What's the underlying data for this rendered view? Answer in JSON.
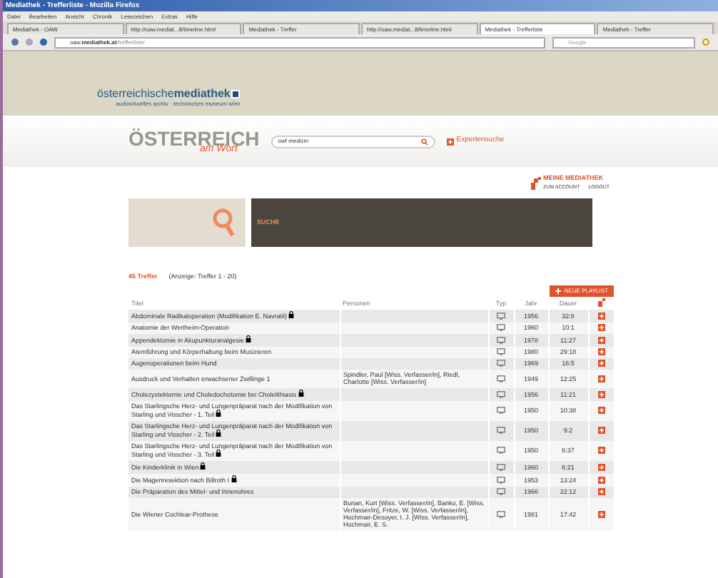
{
  "window": {
    "title": "Mediathek - Trefferliste - Mozilla Firefox"
  },
  "menu": [
    "Datei",
    "Bearbeiten",
    "Ansicht",
    "Chronik",
    "Lesezeichen",
    "Extras",
    "Hilfe"
  ],
  "tabs": [
    {
      "label": "Mediathek - OAW",
      "selected": false
    },
    {
      "label": "http://oaw.mediat...8/timeline.html",
      "selected": false
    },
    {
      "label": "Mediathek - Treffer",
      "selected": false
    },
    {
      "label": "http://oaw.mediat...8/timeline.html",
      "selected": false
    },
    {
      "label": "Mediathek - Trefferliste",
      "selected": true
    },
    {
      "label": "Mediathek - Treffer",
      "selected": false
    }
  ],
  "address": {
    "prefix": "oaw.",
    "domain": "mediathek.at",
    "path": "/trefferliste/"
  },
  "search_engine": {
    "placeholder": "Google"
  },
  "site": {
    "logo_main": "österreichische",
    "logo_bold": "mediathek",
    "logo_sub": "audiovisuelles archiv · technisches museum wien",
    "brand_top": "ÖSTERREICH",
    "brand_bottom": "am Wort",
    "query": "owf medizin",
    "expert_search": "Expertensuche",
    "my_mediathek": "MEINE MEDIATHEK",
    "account": "ZUM ACCOUNT",
    "logout": "LOGOUT",
    "search_panel": "SUCHE"
  },
  "results": {
    "count": "45 Treffer",
    "range": "(Anzeige: Treffer 1 - 20)",
    "new_playlist": "NEUE PLAYLIST"
  },
  "table": {
    "columns": [
      "Titel",
      "Personen",
      "Typ",
      "Jahr",
      "Dauer"
    ],
    "rows": [
      {
        "title": "Abdominale Radikaloperation (Modifikation E. Navratil)",
        "locked": true,
        "persons": "",
        "year": "1956",
        "duration": "32:8"
      },
      {
        "title": "Anatomie der Wertheim-Operation",
        "locked": false,
        "persons": "",
        "year": "1960",
        "duration": "10:1"
      },
      {
        "title": "Appendektomie in Akupunkturanalgesie",
        "locked": true,
        "persons": "",
        "year": "1978",
        "duration": "11:27"
      },
      {
        "title": "Atemführung und Körperhaltung beim Musizieren",
        "locked": false,
        "persons": "",
        "year": "1980",
        "duration": "29:18"
      },
      {
        "title": "Augenoperationen beim Hund",
        "locked": false,
        "persons": "",
        "year": "1969",
        "duration": "16:5"
      },
      {
        "title": "Ausdruck und Verhalten erwachsener Zwillinge 1",
        "locked": false,
        "persons": "Spindler, Paul [Wiss. Verfasser/in], Riedl, Charlotte [Wiss. Verfasser/in]",
        "year": "1949",
        "duration": "12:25"
      },
      {
        "title": "Cholezystektomie und Choledochotomie bei Cholelithiasis",
        "locked": true,
        "persons": "",
        "year": "1956",
        "duration": "11:21"
      },
      {
        "title": "Das Starlingsche Herz- und Lungenpräparat nach der Modifikation von Starling und Visscher - 1. Teil",
        "locked": true,
        "persons": "",
        "year": "1950",
        "duration": "10:38"
      },
      {
        "title": "Das Starlingsche Herz- und Lungenpräparat nach der Modifikation von Starling und Visscher - 2. Teil",
        "locked": true,
        "persons": "",
        "year": "1950",
        "duration": "9:2"
      },
      {
        "title": "Das Starlingsche Herz- und Lungenpräparat nach der Modifikation von Starling und Visscher - 3. Teil",
        "locked": true,
        "persons": "",
        "year": "1950",
        "duration": "6:37"
      },
      {
        "title": "Die Kinderklinik in Wien",
        "locked": true,
        "persons": "",
        "year": "1960",
        "duration": "6:21"
      },
      {
        "title": "Die Magenresektion nach Billroth I",
        "locked": true,
        "persons": "",
        "year": "1953",
        "duration": "13:24"
      },
      {
        "title": "Die Präparation des Mittel- und Innenohres",
        "locked": false,
        "persons": "",
        "year": "1966",
        "duration": "22:12"
      },
      {
        "title": "Die Wiener Cochlear-Prothese",
        "locked": false,
        "persons": "Burian, Kurt [Wiss. Verfasser/in], Banko, E. [Wiss. Verfasser/in], Fritze, W. [Wiss. Verfasser/in], Hochmair-Desoyer, I. J. [Wiss. Verfasser/in], Hochmair, E. S.",
        "year": "1981",
        "duration": "17:42"
      }
    ]
  }
}
